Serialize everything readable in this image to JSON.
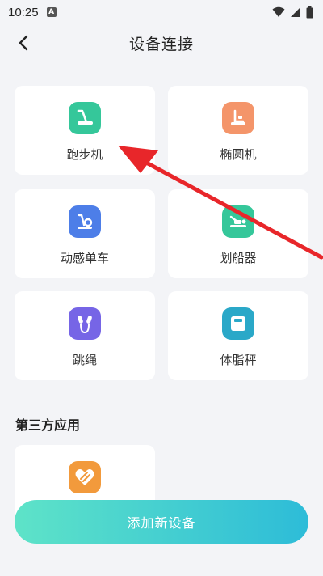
{
  "status_bar": {
    "time": "10:25",
    "notification_letter": "A"
  },
  "header": {
    "title": "设备连接"
  },
  "devices": [
    {
      "label": "跑步机",
      "icon": "treadmill-icon",
      "color": "#35c79a"
    },
    {
      "label": "椭圆机",
      "icon": "elliptical-icon",
      "color": "#f4956a"
    },
    {
      "label": "动感单车",
      "icon": "spin-bike-icon",
      "color": "#4d7ee8"
    },
    {
      "label": "划船器",
      "icon": "rowing-machine-icon",
      "color": "#35c79a"
    },
    {
      "label": "跳绳",
      "icon": "jump-rope-icon",
      "color": "#7665e6"
    },
    {
      "label": "体脂秤",
      "icon": "body-fat-scale-icon",
      "color": "#2aa8c8"
    }
  ],
  "third_party": {
    "title": "第三方应用",
    "apps": [
      {
        "icon": "huawei-health-icon",
        "color": "#f29a3c"
      }
    ]
  },
  "add_button": {
    "label": "添加新设备"
  },
  "annotation": {
    "color": "#e8262a"
  }
}
